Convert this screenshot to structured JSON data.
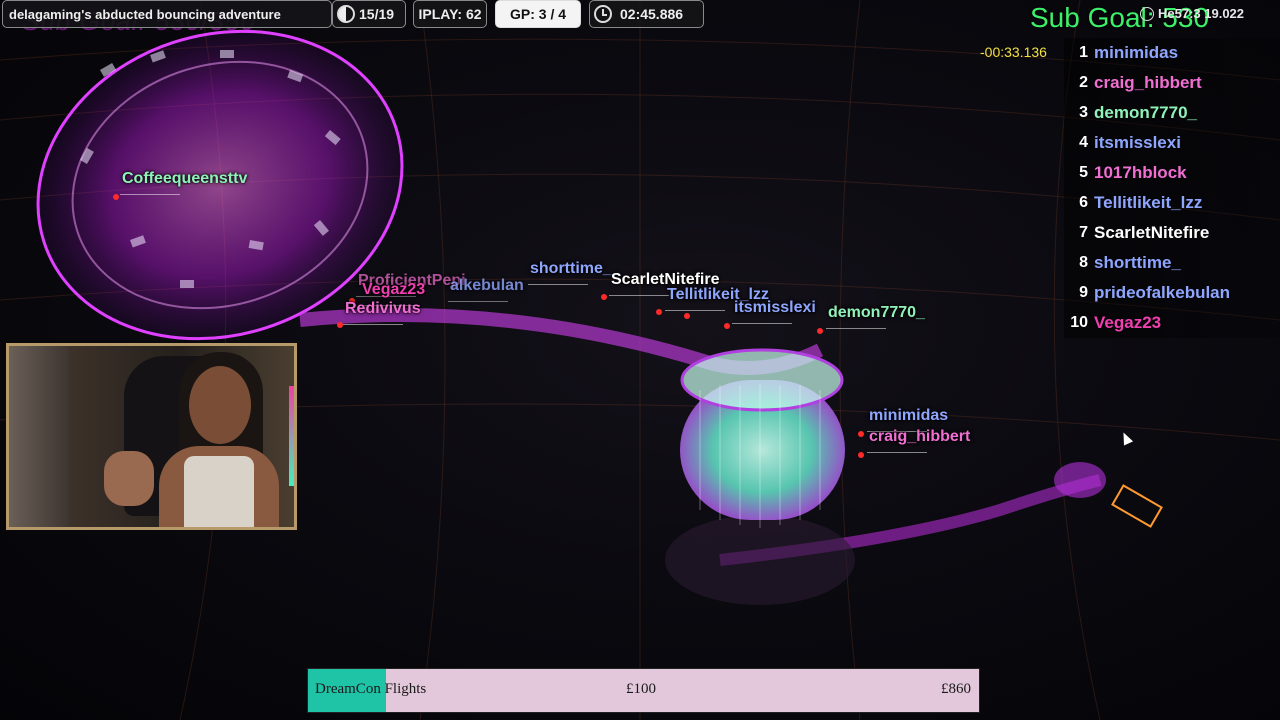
{
  "hud": {
    "title": "delagaming's abducted bouncing adventure",
    "checkpoint": "15/19",
    "iplay": "IPLAY: 62",
    "gp": "GP: 3 / 4",
    "timer": "02:45.886"
  },
  "overlay": {
    "goal_text": "Sub Goal: 530/350",
    "sub_goal": "Sub Goal: 530",
    "top_right": "He57:3 19.022"
  },
  "leaderboard": {
    "gap": "-00:33.136",
    "rows": [
      {
        "pos": "1",
        "name": "minimidas",
        "color": "#8fa6ff"
      },
      {
        "pos": "2",
        "name": "craig_hibbert",
        "color": "#f16fd3"
      },
      {
        "pos": "3",
        "name": "demon7770_",
        "color": "#8ff3b9"
      },
      {
        "pos": "4",
        "name": "itsmisslexi",
        "color": "#8fa6ff"
      },
      {
        "pos": "5",
        "name": "1017hblock",
        "color": "#f16fd3"
      },
      {
        "pos": "6",
        "name": "Tellitlikeit_lzz",
        "color": "#8fa6ff"
      },
      {
        "pos": "7",
        "name": "ScarletNitefire",
        "color": "#ffffff"
      },
      {
        "pos": "8",
        "name": "shorttime_",
        "color": "#8fa6ff"
      },
      {
        "pos": "9",
        "name": "prideofalkebulan",
        "color": "#8fa6ff"
      },
      {
        "pos": "10",
        "name": "Vegaz23",
        "color": "#f13fb0"
      }
    ]
  },
  "tags": {
    "coffee": "Coffeequeensttv",
    "prefix": "ProficientPepi",
    "alke": "alkebulan",
    "vegaz": "Vegaz23",
    "redivivus": "Redivivus",
    "shorttime": "shorttime_",
    "scarlet": "ScarletNitefire",
    "tellit": "Tellitlikeit_lzz",
    "itsmiss": "itsmisslexi",
    "demon": "demon7770_",
    "minimidas": "minimidas",
    "craig": "craig_hibbert"
  },
  "donation": {
    "label": "DreamCon Flights",
    "current": "£100",
    "target": "£860",
    "progress": 0.116
  },
  "colors": {
    "accent_magenta": "#c23cf0",
    "accent_teal": "#1fc3a6",
    "sub_goal_green": "#3cf06a"
  }
}
